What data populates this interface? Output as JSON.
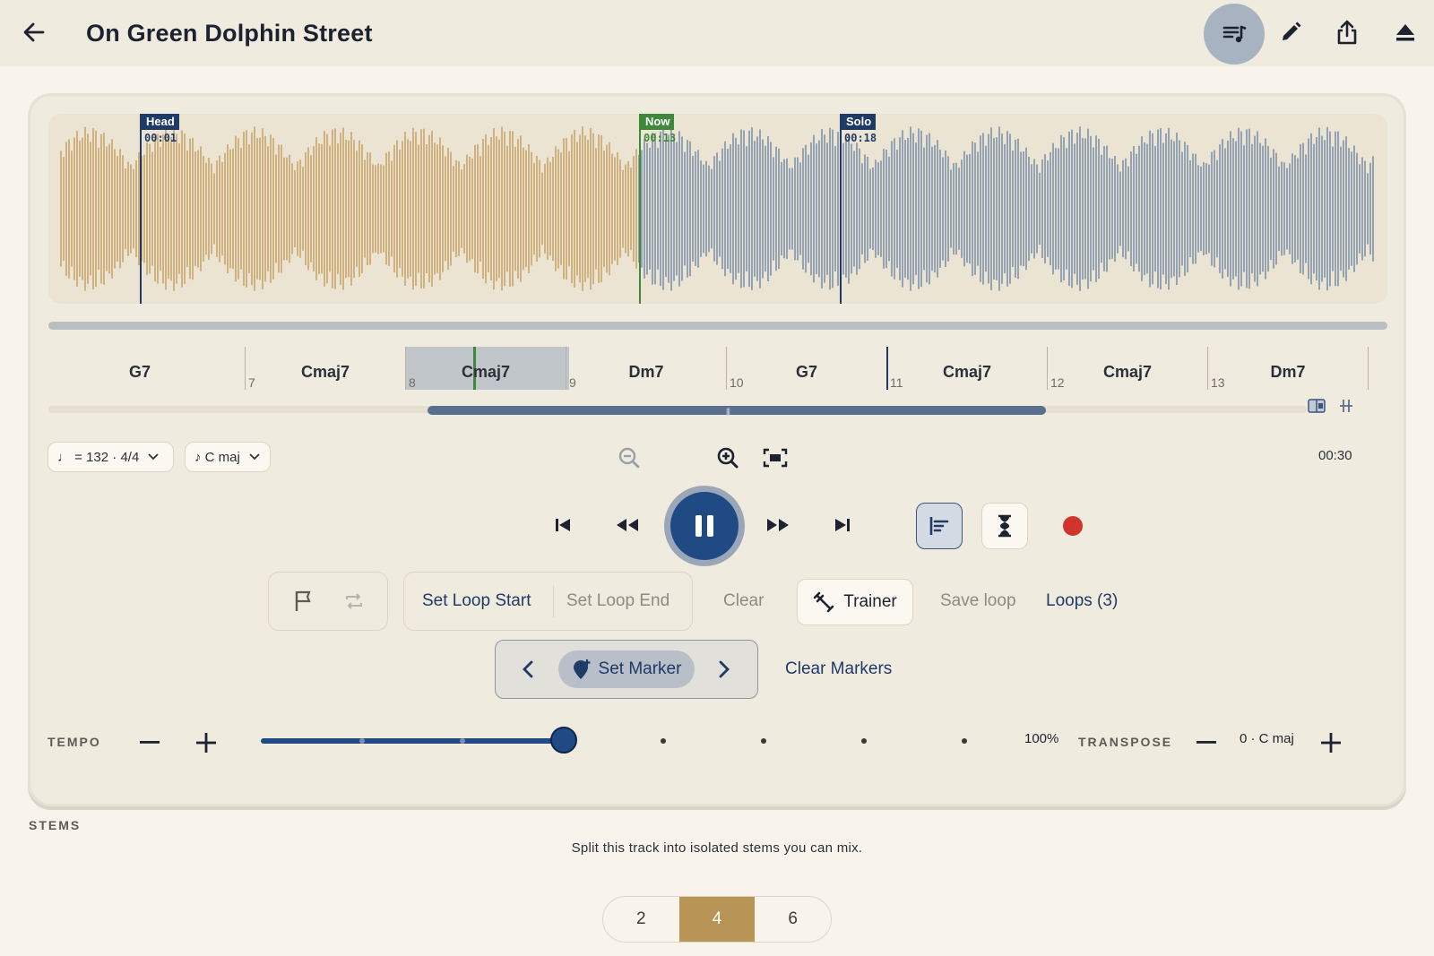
{
  "header": {
    "title": "On Green Dolphin Street"
  },
  "waveform": {
    "markers": [
      {
        "label": "Head",
        "time": "00:01",
        "color": "#1f3a66"
      },
      {
        "label": "Now",
        "time": "00:13",
        "color": "#3f8a3a"
      },
      {
        "label": "Solo",
        "time": "00:18",
        "color": "#1f3a66"
      }
    ],
    "played_color": "#c8a66c",
    "unplayed_color": "#7e93ad"
  },
  "chords": {
    "names": [
      "G7",
      "Cmaj7",
      "Cmaj7",
      "Dm7",
      "G7",
      "Cmaj7",
      "Cmaj7",
      "Dm7"
    ],
    "bars": [
      "7",
      "8",
      "9",
      "10",
      "11",
      "12",
      "13"
    ]
  },
  "controls": {
    "tempo_pill": "♩ = 132 · 4/4",
    "key_pill": "♪ C maj",
    "duration": "00:30"
  },
  "loop": {
    "set_start": "Set Loop Start",
    "set_end": "Set Loop End",
    "clear": "Clear",
    "trainer": "Trainer",
    "save": "Save loop",
    "loops": "Loops (3)"
  },
  "markers": {
    "set_marker": "Set Marker",
    "clear_markers": "Clear Markers"
  },
  "tempo": {
    "label": "TEMPO",
    "value_pct": 100,
    "value_label": "100%"
  },
  "transpose": {
    "label": "TRANSPOSE",
    "value": "0 · C maj"
  },
  "stems": {
    "label": "STEMS",
    "description": "Split this track into isolated stems you can mix.",
    "options": [
      "2",
      "4",
      "6"
    ],
    "selected": "4"
  },
  "colors": {
    "accent": "#1f4a83",
    "record": "#d0342c",
    "gold": "#b89557"
  }
}
